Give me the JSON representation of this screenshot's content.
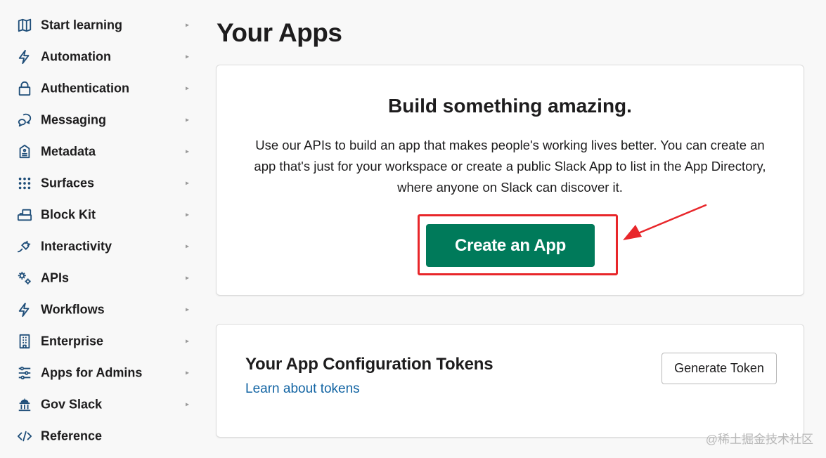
{
  "sidebar": {
    "items": [
      {
        "label": "Start learning",
        "icon": "map-icon"
      },
      {
        "label": "Automation",
        "icon": "lightning-icon"
      },
      {
        "label": "Authentication",
        "icon": "lock-icon"
      },
      {
        "label": "Messaging",
        "icon": "chat-bubbles-icon"
      },
      {
        "label": "Metadata",
        "icon": "document-tag-icon"
      },
      {
        "label": "Surfaces",
        "icon": "dots-grid-icon"
      },
      {
        "label": "Block Kit",
        "icon": "blocks-icon"
      },
      {
        "label": "Interactivity",
        "icon": "plug-icon"
      },
      {
        "label": "APIs",
        "icon": "gears-icon"
      },
      {
        "label": "Workflows",
        "icon": "lightning-icon"
      },
      {
        "label": "Enterprise",
        "icon": "building-icon"
      },
      {
        "label": "Apps for Admins",
        "icon": "sliders-icon"
      },
      {
        "label": "Gov Slack",
        "icon": "government-building-icon"
      },
      {
        "label": "Reference",
        "icon": "code-icon"
      }
    ],
    "chevron": "▸"
  },
  "main": {
    "title": "Your Apps",
    "build_card": {
      "heading": "Build something amazing.",
      "description": "Use our APIs to build an app that makes people's working lives better. You can create an app that's just for your workspace or create a public Slack App to list in the App Directory, where anyone on Slack can discover it.",
      "create_button": "Create an App"
    },
    "tokens_card": {
      "heading": "Your App Configuration Tokens",
      "link": "Learn about tokens",
      "generate_button": "Generate Token"
    }
  },
  "watermark": "@稀土掘金技术社区",
  "colors": {
    "accent_green": "#007a5a",
    "link_blue": "#1264a3",
    "icon_blue": "#1f4e79",
    "annotation_red": "#e8262a"
  }
}
